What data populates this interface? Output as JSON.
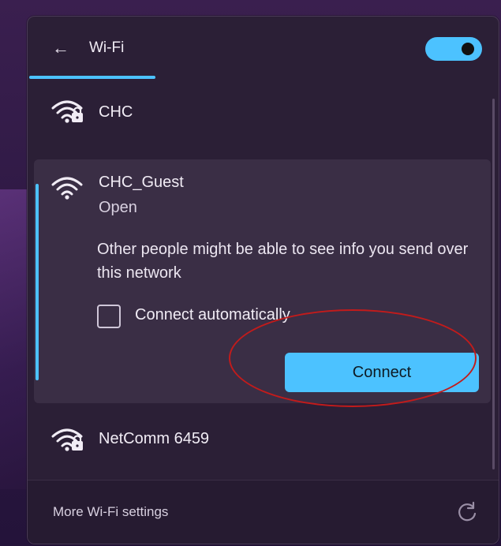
{
  "header": {
    "title": "Wi-Fi",
    "back_icon": "arrow-left-icon",
    "wifi_enabled": true,
    "accent_color": "#4cc2ff"
  },
  "networks": [
    {
      "name": "CHC",
      "secured": true,
      "icon": "wifi-secured-icon"
    },
    {
      "name": "CHC_Guest",
      "secured": false,
      "status": "Open",
      "icon": "wifi-open-icon",
      "expanded": true,
      "warning": "Other people might be able to see info you send over this network",
      "auto_connect_label": "Connect automatically",
      "auto_connect_checked": false,
      "connect_label": "Connect"
    },
    {
      "name": "NetComm 6459",
      "secured": true,
      "icon": "wifi-secured-icon"
    }
  ],
  "footer": {
    "settings_link": "More Wi-Fi settings",
    "refresh_icon": "refresh-icon"
  },
  "annotation": {
    "type": "red-ellipse",
    "color": "#c21b1b",
    "target": "Connect"
  }
}
